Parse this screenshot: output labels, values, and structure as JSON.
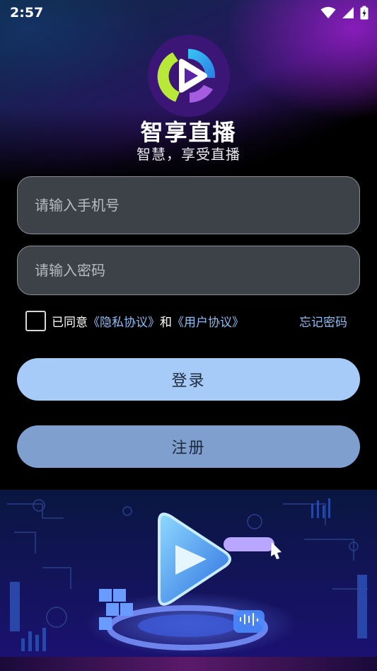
{
  "status_bar": {
    "time": "2:57",
    "icons": [
      "wifi-icon",
      "signal-icon",
      "battery-icon"
    ]
  },
  "app": {
    "title": "智享直播",
    "subtitle": "智慧，享受直播",
    "logo_icon": "play-logo-icon"
  },
  "form": {
    "phone_placeholder": "请输入手机号",
    "phone_value": "",
    "password_placeholder": "请输入密码",
    "password_value": "",
    "agree_checked": false,
    "agree_prefix": "已同意",
    "privacy_link": "《隐私协议》",
    "and_text": "和",
    "user_link": "《用户协议》",
    "forgot_label": "忘记密码"
  },
  "buttons": {
    "login": "登录",
    "register": "注册"
  },
  "colors": {
    "login_button": "#a6cbf8",
    "register_button": "#7f9fcf",
    "link": "#8fbef4",
    "field_bg": "#3d4148"
  }
}
